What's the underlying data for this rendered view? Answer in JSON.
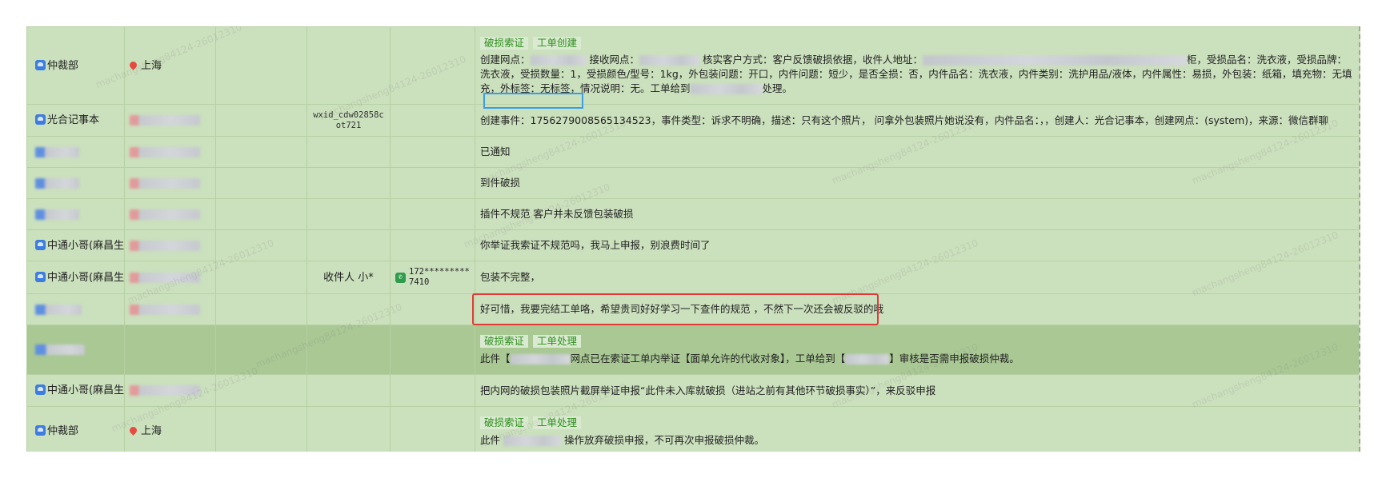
{
  "watermark": "machangsheng84124-26012310",
  "rows": [
    {
      "operator": "仲裁部",
      "location": "上海",
      "wxid": "",
      "receiver": "",
      "phone": "",
      "tags": [
        "破损索证",
        "工单创建"
      ],
      "description_parts": [
        "创建网点：",
        "接收网点：",
        "核实客户方式：客户反馈破损依据，收件人地址：",
        "柜，受损品名：洗衣液，受损品牌：洗衣液，受损数量：1，受损颜色/型号：1kg，外包装问题：开口，内件问题：短少，是否全损：否，内件品名：洗衣液，内件类别：洗护用品/液体，内件属性：易损，外包装：纸箱，填充物：无填充，外标签：无标签，情况说明：无。工单给到",
        "处理。"
      ]
    },
    {
      "operator": "光合记事本",
      "location": "",
      "wxid": "wxid_cdw02858cot721",
      "receiver": "",
      "phone": "",
      "tags": [],
      "description": "创建事件：1756279008565134523，事件类型：诉求不明确，描述：只有这个照片， 问拿外包装照片她说没有，内件品名：，，创建人：光合记事本，创建网点：(system)，来源：微信群聊"
    },
    {
      "operator": "",
      "location": "",
      "wxid": "",
      "receiver": "",
      "phone": "",
      "tags": [],
      "description": "已通知"
    },
    {
      "operator": "",
      "location": "",
      "wxid": "",
      "receiver": "",
      "phone": "",
      "tags": [],
      "description": "到件破损"
    },
    {
      "operator": "",
      "location": "",
      "wxid": "",
      "receiver": "",
      "phone": "",
      "tags": [],
      "description": "插件不规范 客户并未反馈包装破损"
    },
    {
      "operator": "中通小哥(麻昌生)",
      "location": "",
      "wxid": "",
      "receiver": "",
      "phone": "",
      "tags": [],
      "description": "你举证我索证不规范吗，我马上申报，别浪费时间了"
    },
    {
      "operator": "中通小哥(麻昌生)",
      "location": "",
      "wxid": "",
      "receiver": "收件人 小*",
      "phone": "172*********7410",
      "tags": [],
      "description": "包装不完整，"
    },
    {
      "operator": "",
      "location": "",
      "wxid": "",
      "receiver": "",
      "phone": "",
      "tags": [],
      "description": "好可惜，我要完结工单咯，希望贵司好好学习一下查件的规范 ，不然下一次还会被反驳的哦"
    },
    {
      "operator": "",
      "location": "",
      "wxid": "",
      "receiver": "",
      "phone": "",
      "tags": [
        "破损索证",
        "工单处理"
      ],
      "description_parts": [
        "此件【",
        "网点已在索证工单内举证【面单允许的代收对象】，工单给到【",
        "】审核是否需申报破损仲裁。"
      ]
    },
    {
      "operator": "中通小哥(麻昌生)",
      "location": "",
      "wxid": "",
      "receiver": "",
      "phone": "",
      "tags": [],
      "description": "把内网的破损包装照片截屏举证申报“此件未入库就破损（进站之前有其他环节破损事实）”，来反驳申报"
    },
    {
      "operator": "仲裁部",
      "location": "上海",
      "wxid": "",
      "receiver": "",
      "phone": "",
      "tags": [
        "破损索证",
        "工单处理"
      ],
      "description_parts": [
        "此件",
        "操作放弃破损申报，不可再次申报破损仲裁。"
      ]
    }
  ]
}
